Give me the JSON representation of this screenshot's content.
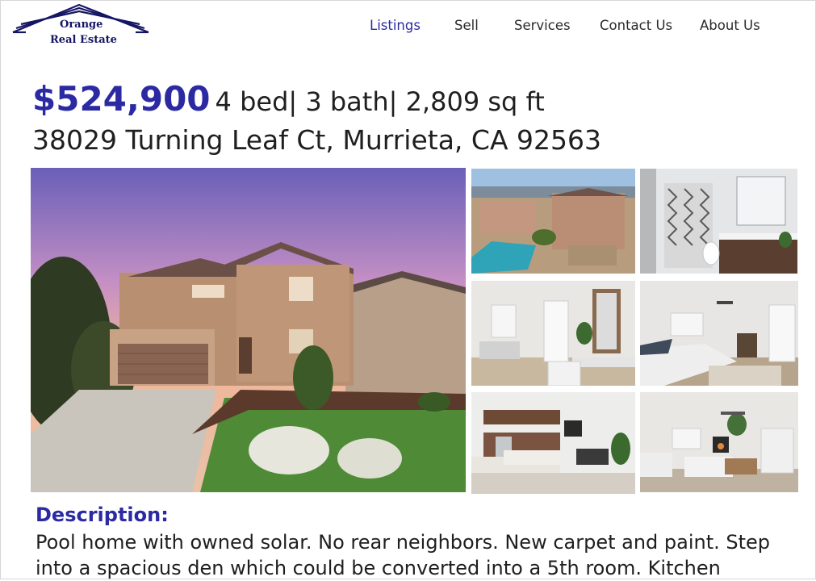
{
  "brand": {
    "line1": "Orange",
    "line2": "Real Estate"
  },
  "nav": {
    "items": [
      {
        "label": "Listings",
        "active": true
      },
      {
        "label": "Sell",
        "active": false
      },
      {
        "label": "Services",
        "active": false
      },
      {
        "label": "Contact Us",
        "active": false
      },
      {
        "label": "About Us",
        "active": false
      }
    ]
  },
  "listing": {
    "price": "$524,900",
    "specs": "4 bed| 3 bath| 2,809 sq ft",
    "address": "38029 Turning Leaf Ct, Murrieta, CA 92563"
  },
  "description": {
    "title": "Description:",
    "text": "Pool home with owned solar. No rear neighbors. New carpet and paint. Step into a spacious den which could be converted into a 5th room. Kitchen"
  },
  "colors": {
    "accent": "#2b2aa3",
    "logo": "#151565"
  }
}
